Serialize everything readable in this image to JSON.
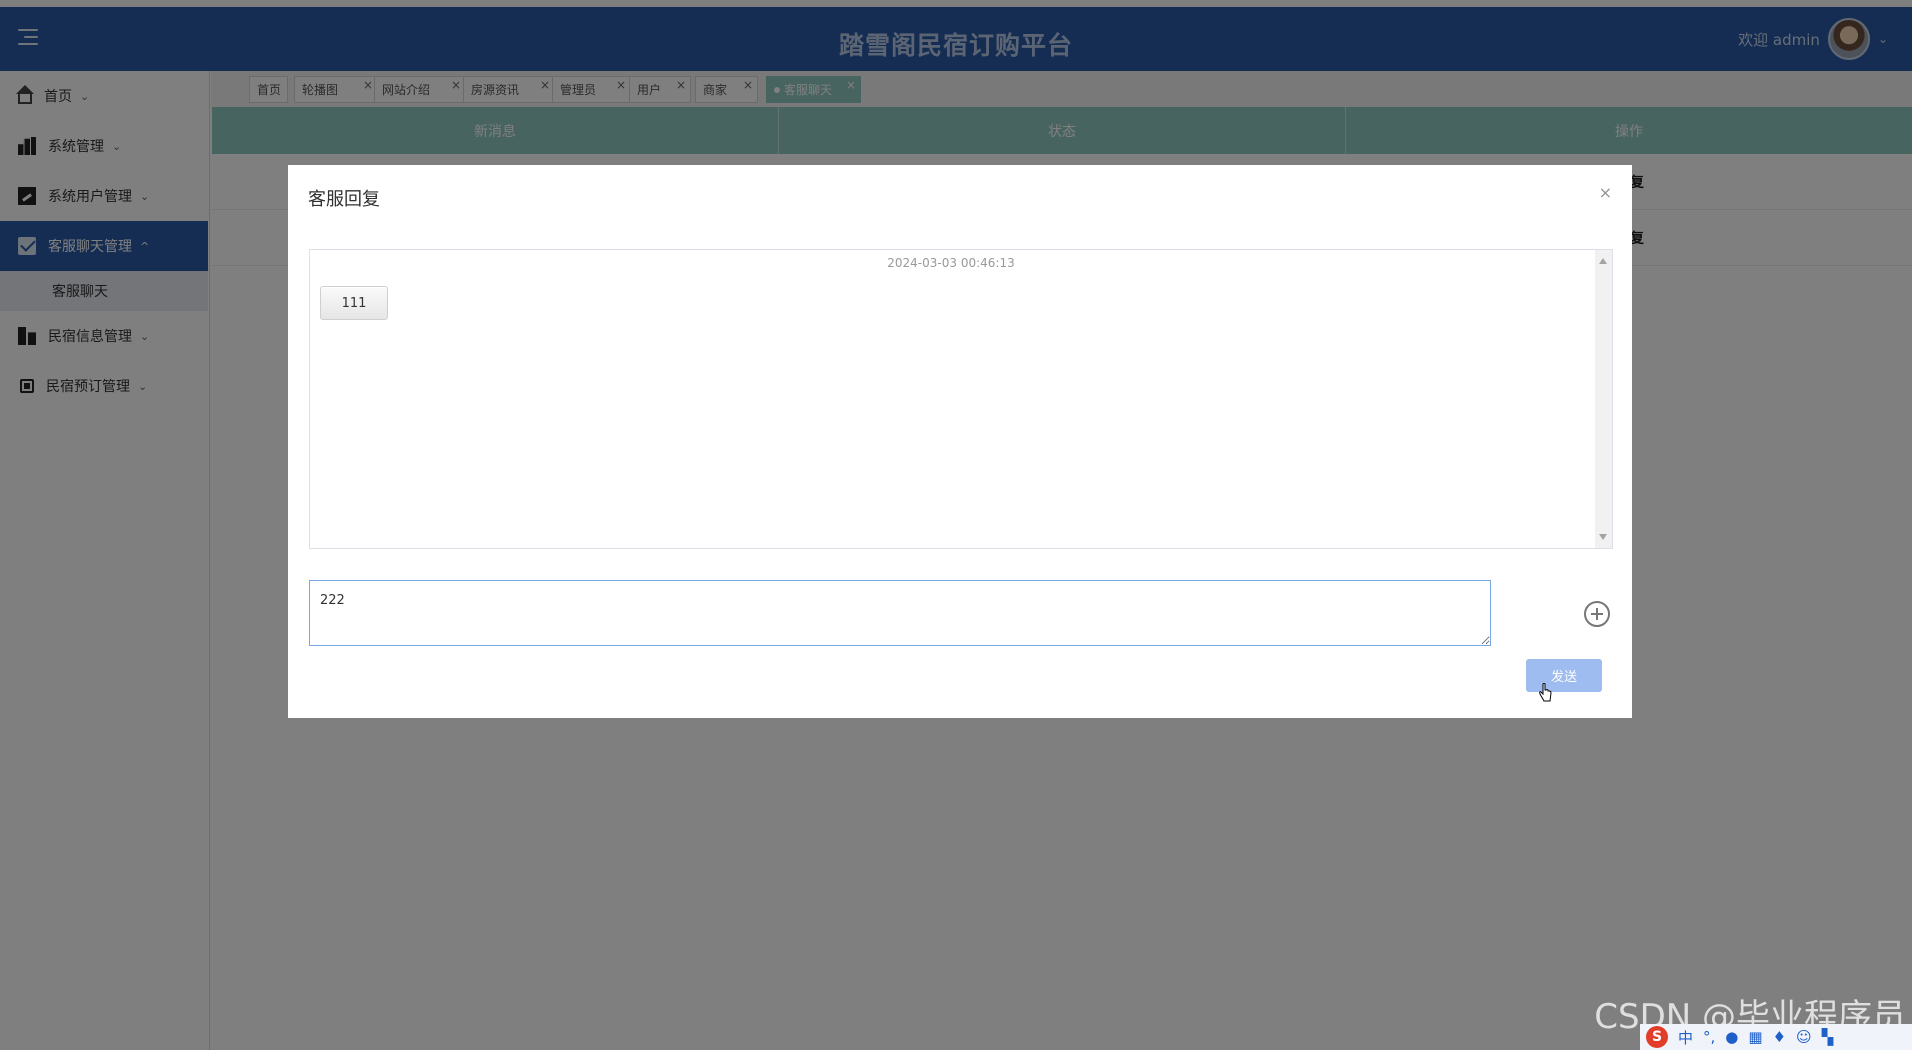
{
  "header": {
    "title": "踏雪阁民宿订购平台",
    "welcome": "欢迎 admin"
  },
  "sidebar": {
    "items": [
      {
        "label": "首页",
        "icon": "home-icon"
      },
      {
        "label": "系统管理",
        "icon": "bar-chart-icon"
      },
      {
        "label": "系统用户管理",
        "icon": "edit-square-icon"
      },
      {
        "label": "客服聊天管理",
        "icon": "mail-icon",
        "expanded": true
      },
      {
        "label": "民宿信息管理",
        "icon": "building-icon"
      },
      {
        "label": "民宿预订管理",
        "icon": "chip-icon"
      }
    ],
    "submenu": {
      "label": "客服聊天"
    }
  },
  "tabs": [
    {
      "label": "首页"
    },
    {
      "label": "轮播图"
    },
    {
      "label": "网站介绍"
    },
    {
      "label": "房源资讯"
    },
    {
      "label": "管理员"
    },
    {
      "label": "用户"
    },
    {
      "label": "商家"
    },
    {
      "label": "客服聊天",
      "current": true
    }
  ],
  "table": {
    "columns": [
      "新消息",
      "状态",
      "操作"
    ],
    "rows": [
      {
        "action": "复"
      },
      {
        "action": "复"
      }
    ]
  },
  "modal": {
    "title": "客服回复",
    "close": "×",
    "messages": [
      {
        "time": "2024-03-03 00:46:13",
        "text": "111"
      }
    ],
    "input_value": "222",
    "send_label": "发送"
  },
  "watermark": "CSDN @毕业程序员",
  "ime": {
    "mode": "中"
  },
  "colors": {
    "header": "#2a5aa7",
    "table_head": "#8fc8c0",
    "send_button": "#9ebcef"
  }
}
